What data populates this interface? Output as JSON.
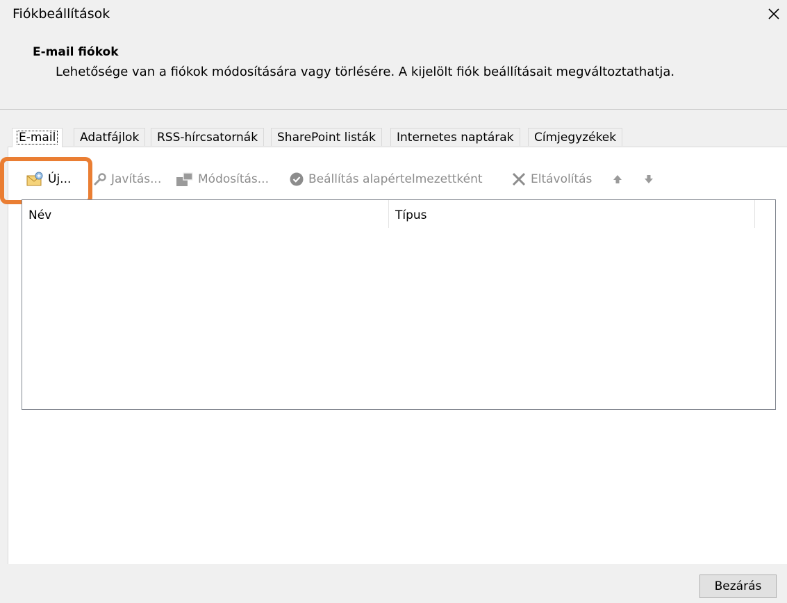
{
  "window": {
    "title": "Fiókbeállítások",
    "close_icon": "close-icon"
  },
  "header": {
    "title": "E-mail fiókok",
    "description": "Lehetősége van a fiókok módosítására vagy törlésére. A kijelölt fiók beállításait megváltoztathatja."
  },
  "tabs": [
    {
      "label": "E-mail",
      "active": true
    },
    {
      "label": "Adatfájlok",
      "active": false
    },
    {
      "label": "RSS-hírcsatornák",
      "active": false
    },
    {
      "label": "SharePoint listák",
      "active": false
    },
    {
      "label": "Internetes naptárak",
      "active": false
    },
    {
      "label": "Címjegyzékek",
      "active": false
    }
  ],
  "toolbar": {
    "new_label": "Új...",
    "repair_label": "Javítás...",
    "change_label": "Módosítás...",
    "set_default_label": "Beállítás alapértelmezettként",
    "remove_label": "Eltávolítás",
    "move_up_icon": "arrow-up-icon",
    "move_down_icon": "arrow-down-icon"
  },
  "list": {
    "columns": [
      "Név",
      "Típus"
    ],
    "rows": []
  },
  "footer": {
    "close_label": "Bezárás"
  },
  "colors": {
    "highlight": "#ea7e33",
    "disabled_text": "#8c8c8c"
  }
}
